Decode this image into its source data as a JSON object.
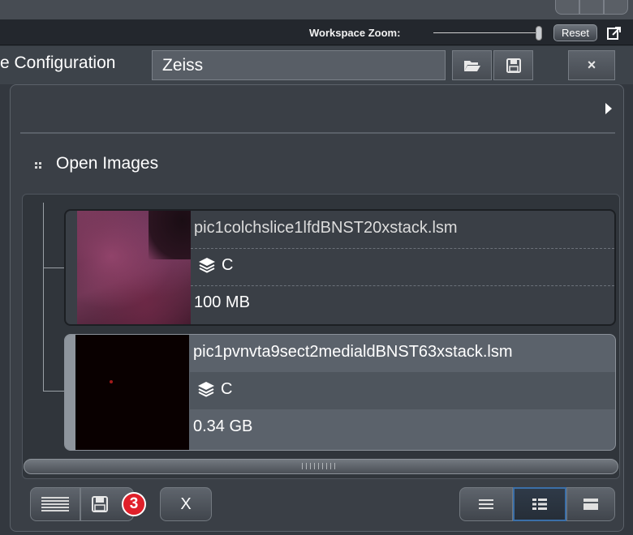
{
  "toolbar": {
    "workspace_zoom_label": "Workspace Zoom:",
    "workspace_zoom_level": 0.97,
    "reset_label": "Reset"
  },
  "configuration": {
    "label": "e Configuration",
    "value": "Zeiss",
    "buttons": [
      "folder-open-icon",
      "save-icon",
      "close-icon"
    ],
    "close_label": "×"
  },
  "open_images": {
    "title": "Open Images",
    "images": [
      {
        "filename": "pic1colchslice1lfdBNST20xstack.lsm",
        "channel": "C",
        "size": "100 MB",
        "selected": false
      },
      {
        "filename": "pic1pvnvta9sect2medialdBNST63xstack.lsm",
        "channel": "C",
        "size": "0.34 GB",
        "selected": true
      }
    ]
  },
  "bottom_toolbar": {
    "close_label": "X",
    "badge": "3",
    "active_view": "list-detail"
  },
  "colors": {
    "background": "#33383f",
    "selected_card": "#5b626b",
    "active_view_border": "#3b6fa8",
    "badge": "#e0202a"
  }
}
